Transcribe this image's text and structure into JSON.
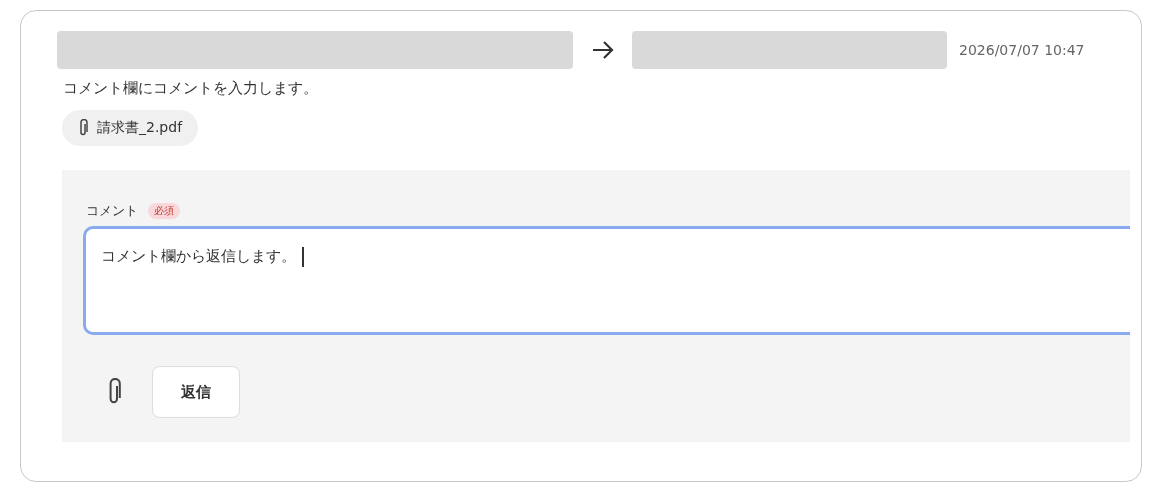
{
  "header": {
    "timestamp": "2026/07/07 10:47"
  },
  "message": "コメント欄にコメントを入力します。",
  "attachments": [
    {
      "name": "請求書_2.pdf"
    }
  ],
  "reply": {
    "label": "コメント",
    "required_badge": "必須",
    "value": "コメント欄から返信します。",
    "focused": true,
    "button": "返信"
  }
}
